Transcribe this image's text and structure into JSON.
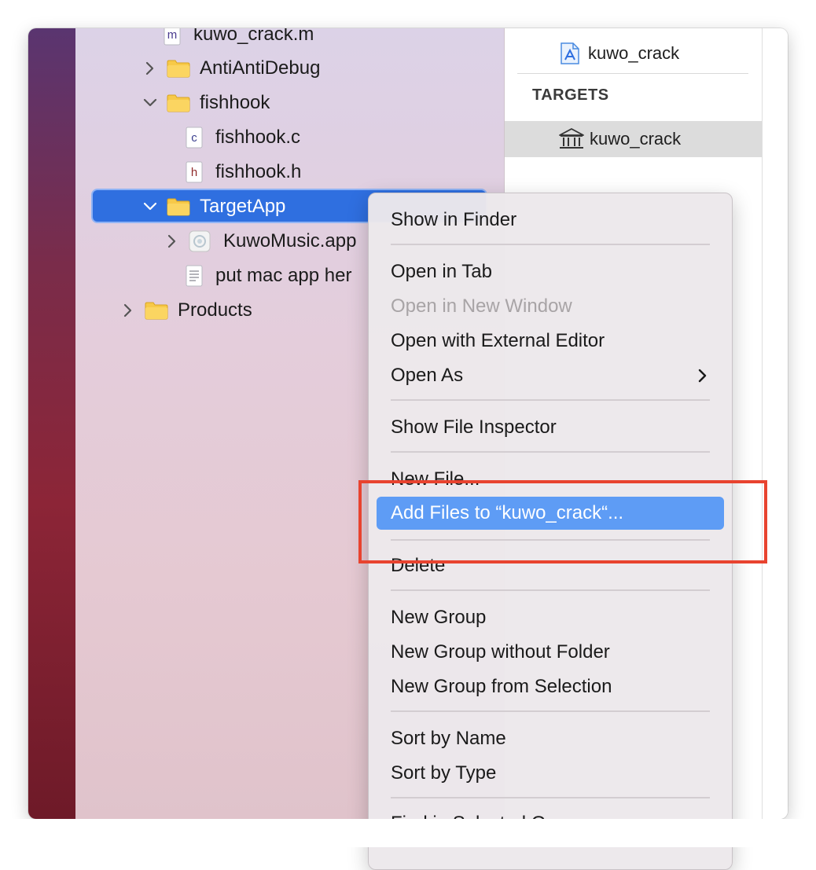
{
  "navigator": {
    "items": [
      {
        "label": "kuwo_crack.m",
        "badge": "m",
        "kind": "file"
      },
      {
        "label": "AntiAntiDebug",
        "kind": "folder",
        "expanded": false
      },
      {
        "label": "fishhook",
        "kind": "folder",
        "expanded": true
      },
      {
        "label": "fishhook.c",
        "badge": "c",
        "kind": "file"
      },
      {
        "label": "fishhook.h",
        "badge": "h",
        "kind": "file"
      },
      {
        "label": "TargetApp",
        "kind": "folder",
        "expanded": true,
        "selected": true
      },
      {
        "label": "KuwoMusic.app",
        "kind": "app",
        "expanded": false
      },
      {
        "label": "put mac app her",
        "kind": "text-file"
      },
      {
        "label": "Products",
        "kind": "folder",
        "expanded": false
      }
    ]
  },
  "project_editor": {
    "project_name": "kuwo_crack",
    "targets_heading": "TARGETS",
    "target_name": "kuwo_crack"
  },
  "context_menu": {
    "items": [
      {
        "label": "Show in Finder"
      },
      {
        "label": "Open in Tab"
      },
      {
        "label": "Open in New Window",
        "disabled": true
      },
      {
        "label": "Open with External Editor"
      },
      {
        "label": "Open As",
        "submenu": true
      },
      {
        "label": "Show File Inspector"
      },
      {
        "label": "New File..."
      },
      {
        "label": "Add Files to “kuwo_crack“...",
        "highlighted": true
      },
      {
        "label": "Delete"
      },
      {
        "label": "New Group"
      },
      {
        "label": "New Group without Folder"
      },
      {
        "label": "New Group from Selection"
      },
      {
        "label": "Sort by Name"
      },
      {
        "label": "Sort by Type"
      },
      {
        "label": "Find in Selected Groups..."
      }
    ]
  },
  "colors": {
    "selection": "#2f6fe0",
    "menu_highlight": "#5e9cf5",
    "annotation": "#e8432f",
    "folder": "#f7c948"
  }
}
